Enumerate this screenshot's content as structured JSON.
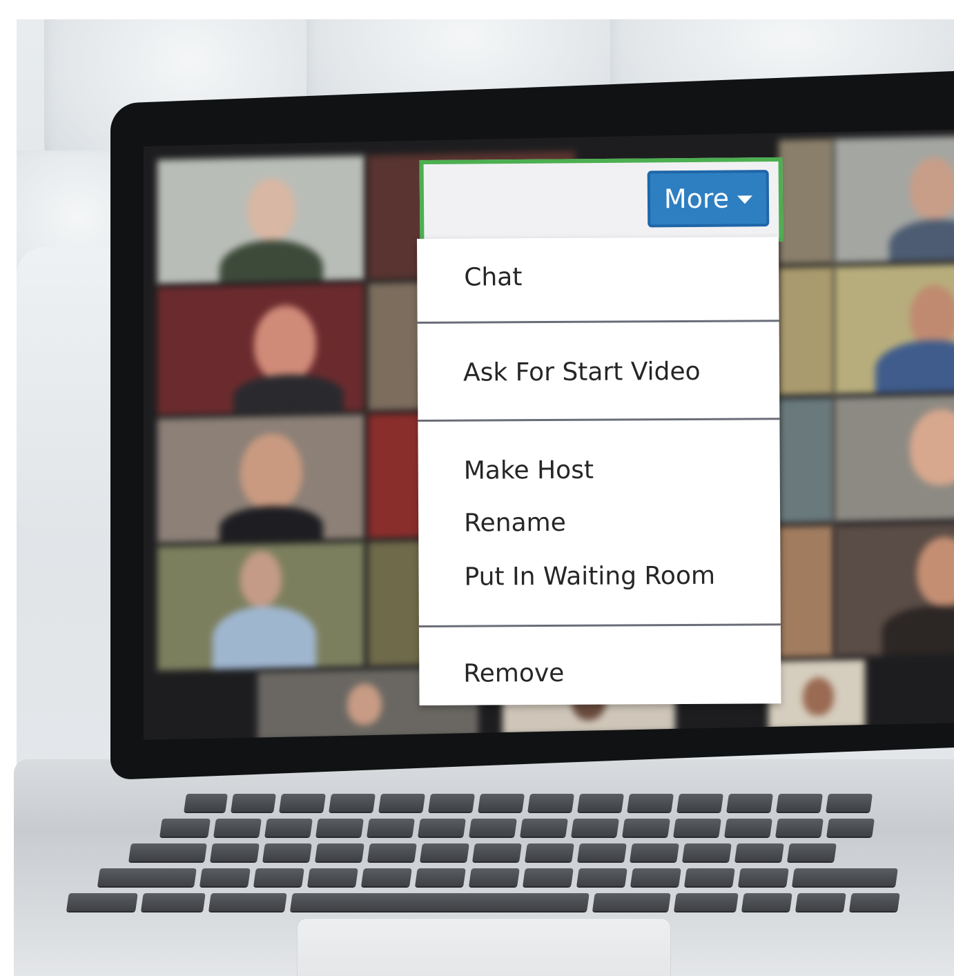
{
  "menu": {
    "more_label": "More",
    "items": [
      {
        "label": "Chat"
      },
      {
        "label": "Ask For Start Video"
      },
      {
        "label": "Make Host"
      },
      {
        "label": "Rename"
      },
      {
        "label": "Put In Waiting Room"
      },
      {
        "label": "Remove"
      }
    ]
  },
  "colors": {
    "highlight_border": "#4caf50",
    "button_blue": "#2d7fc1",
    "menu_background": "#ffffff",
    "header_background": "#f1f1f3"
  },
  "icons": {
    "more_caret": "caret-down-icon"
  }
}
